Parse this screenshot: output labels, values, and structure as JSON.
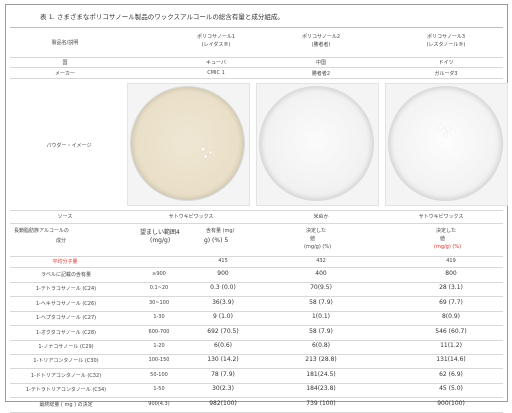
{
  "title": "表 1. さまざまなポリコサノール製品のワックスアルコールの総含有量と成分組成。",
  "columns": {
    "label": "製品名/説明",
    "products": [
      {
        "name": "ポリコサノール1",
        "sub": "(レイダス®)"
      },
      {
        "name": "ポリコサノール2",
        "sub": "(勝者者)"
      },
      {
        "name": "ポリコサノール3",
        "sub": "(レスタノール®)"
      }
    ]
  },
  "country_row": {
    "label": "国",
    "values": [
      "キューバ",
      "中国",
      "ドイツ"
    ]
  },
  "maker_row": {
    "label": "メーカー",
    "values": [
      "CMIC 1",
      "勝者者2",
      "ガルーダ3"
    ]
  },
  "image_row": {
    "label": "パウダー・イメージ"
  },
  "source_row": {
    "label": "ソース",
    "values": [
      "サトウキビワックス",
      "米ぬか",
      "サトウキビワックス"
    ]
  },
  "header_row": {
    "label_line1": "長鎖脂肪族アルコールの",
    "label_line2": "成分",
    "col2_line1": "望ましい範囲4",
    "col2_line2": "(mg/g)",
    "col3_line1": "含有量 (mg/",
    "col3_line2": "g) (%) 5",
    "col4_line1": "決定した",
    "col4_line2": "値",
    "col4_line3": "(mg/g) (%)",
    "col5_line1": "決定した",
    "col5_line2": "値",
    "col5_line3": "(mg/g) (%)"
  },
  "mw_row": {
    "label": "平均分子量",
    "values": [
      "",
      "415",
      "432",
      "419"
    ]
  },
  "rows": [
    {
      "label": "ラベルに記載の含有量",
      "values": [
        "≥900",
        "900",
        "400",
        "800"
      ]
    },
    {
      "label": "1-テトラコサノール (C24)",
      "values": [
        "0.1~20",
        "0.3 (0.0)",
        "70(9.5)",
        "28 (3.1)"
      ]
    },
    {
      "label": "1-ヘキサコサノール (C26)",
      "values": [
        "30~100",
        "36(3.9)",
        "58 (7.9)",
        "69 (7.7)"
      ]
    },
    {
      "label": "1-ヘプタコサノール (C27)",
      "values": [
        "1-30",
        "9 (1.0)",
        "1(0.1)",
        "8(0.9)"
      ]
    },
    {
      "label": "1-オクタコサノール (C28)",
      "values": [
        "600-700",
        "692 (70.5)",
        "58 (7.9)",
        "546 (60.7)"
      ]
    },
    {
      "label": "1-ノナコサノール (C29)",
      "values": [
        "1-20",
        "6(0.6)",
        "6(0.8)",
        "11(1.2)"
      ]
    },
    {
      "label": "1-トリアコンタノール (C30)",
      "values": [
        "100-150",
        "130 (14.2)",
        "213 (28.8)",
        "131(14.6)"
      ]
    },
    {
      "label": "1-ドトリアコンタノール (C32)",
      "values": [
        "50-100",
        "78 (7.9)",
        "181(24.5)",
        "62 (6.9)"
      ]
    },
    {
      "label": "1-テトラトリアコンタノール (C34)",
      "values": [
        "1-50",
        "30(2.3)",
        "184(23.8)",
        "45 (5.0)"
      ]
    },
    {
      "label": "最終総量 ( mg ) の決定",
      "values": [
        "900(4.3)",
        "982(100)",
        "739 (100)",
        "900(100)"
      ]
    }
  ],
  "colors": {
    "accent_red": "#d0342c",
    "rule": "#d8d8d8",
    "border": "#9a9a9a"
  }
}
